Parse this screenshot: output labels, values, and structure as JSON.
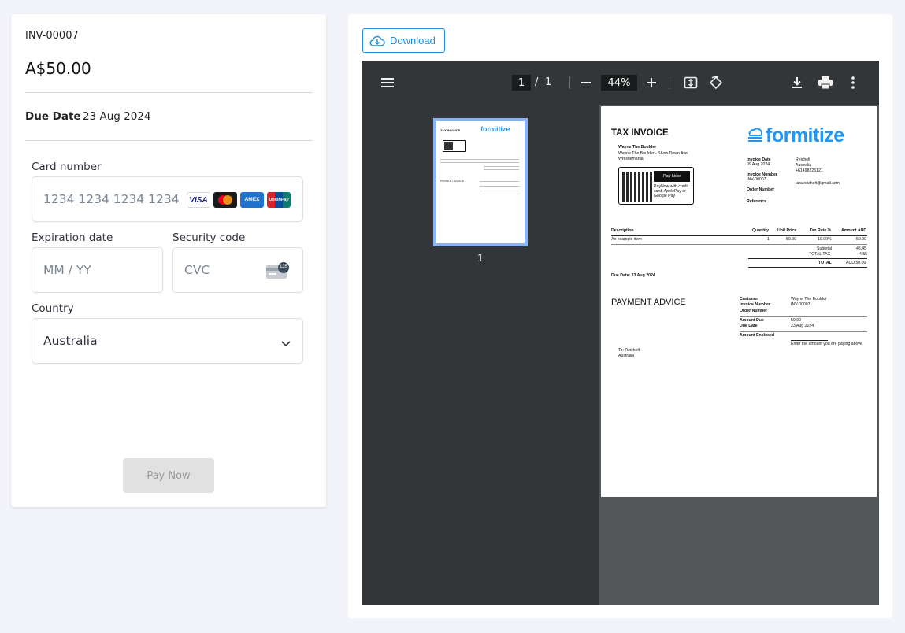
{
  "invoice": {
    "number": "INV-00007",
    "amount": "A$50.00",
    "due_label": "Due Date",
    "due_value": "23 Aug 2024"
  },
  "form": {
    "card_number_label": "Card number",
    "card_number_placeholder": "1234 1234 1234 1234",
    "card_brands": [
      "VISA",
      "mastercard",
      "AMEX",
      "UnionPay"
    ],
    "expiry_label": "Expiration date",
    "expiry_placeholder": "MM / YY",
    "cvc_label": "Security code",
    "cvc_placeholder": "CVC",
    "cvc_badge": "135",
    "country_label": "Country",
    "country_value": "Australia",
    "pay_button": "Pay Now"
  },
  "preview": {
    "download_label": "Download",
    "page_current": "1",
    "page_sep": "/",
    "page_total": "1",
    "zoom": "44%",
    "thumb_label": "1",
    "icons": [
      "menu-icon",
      "zoom-out-icon",
      "zoom-in-icon",
      "fit-page-icon",
      "rotate-icon",
      "download-icon",
      "print-icon",
      "more-vert-icon"
    ]
  },
  "document": {
    "title": "TAX INVOICE",
    "logo": "formitize",
    "from_name": "Wayne The Boulder",
    "from_address": "Wayne The Boulder - Show Down Ave",
    "from_city": "Wrestlemania",
    "pay_now": "Pay Now",
    "paynow_text_1": "PayNow with credit",
    "paynow_text_2": "card, ApplePay or",
    "paynow_text_3": "Google Pay",
    "invoice_date_label": "Invoice Date",
    "invoice_date": "09 Aug 2024",
    "invoice_number_label": "Invoice Number",
    "invoice_number": "INV-00007",
    "order_number_label": "Order Number",
    "reference_label": "Reference",
    "to_name": "Reichelt",
    "to_country": "Australia",
    "to_phone": "+61498225121",
    "to_email": "tara.reichelt@gmail.com",
    "col_description": "Description",
    "col_quantity": "Quantity",
    "col_unit_price": "Unit Price",
    "col_tax_rate": "Tax Rate %",
    "col_amount": "Amount AUD",
    "item_desc": "An example item",
    "item_qty": "1",
    "item_price": "50.00",
    "item_tax": "10.00%",
    "item_amount": "50.00",
    "subtotal_label": "Subtotal",
    "subtotal": "45.45",
    "total_tax_label": "TOTAL TAX",
    "total_tax": "4.55",
    "total_label": "TOTAL",
    "total": "AUD 50.00",
    "due_date_line": "Due Date: 23 Aug 2024",
    "payment_advice": "PAYMENT ADVICE",
    "pa_customer_label": "Customer",
    "pa_customer": "Wayne The Boulder",
    "pa_invoice_label": "Invoice Number",
    "pa_invoice": "INV-00007",
    "pa_order_label": "Order Number",
    "pa_amount_due_label": "Amount Due",
    "pa_amount_due": "50.00",
    "pa_due_date_label": "Due Date",
    "pa_due_date": "23 Aug 2024",
    "pa_enclosed_label": "Amount Enclosed",
    "pa_enclosed_hint": "Enter the amount you are paying above",
    "to_line": "To: Reichelt",
    "to_line_country": "Australia"
  }
}
